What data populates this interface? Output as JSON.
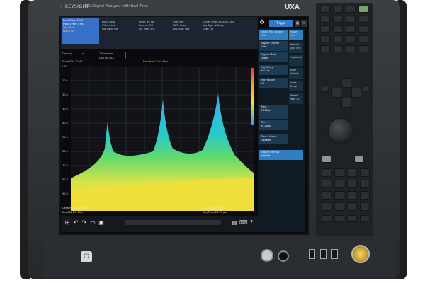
{
  "device": {
    "brand": "KEYSIGHT",
    "title": "UXA Signal Analyzer with Real-Time",
    "model": "UXA"
  },
  "screen": {
    "control_box": {
      "line1": "Real-Time: 3.0.5",
      "line2": "Sync Time: 3 ms",
      "line3": "Trig: Free",
      "line4": "Input: RF"
    },
    "info_cols": [
      [
        "PNO: Close",
        "IFGain: Low",
        "Sig Track: Off"
      ],
      [
        "Atten: 10 dB",
        "Preamp: Off",
        "µW Path: Std"
      ],
      [
        "Trig: Free",
        "PA/C: Swep",
        "Avg Type: Log"
      ],
      [
        "Center Freq: 5.00000 GHz",
        "Avg Type: Voltage",
        "Gate: Off"
      ]
    ],
    "sub_bar": {
      "view_label": "Density",
      "box_line1": "1 Spectrum",
      "box_line2": "DIGITAL OLS",
      "scale": "Scale/Div 10 dB",
      "ref": "Ref Level 0.00 dBm"
    },
    "y_labels": [
      "0.00",
      "-10.0",
      "-20.0",
      "-30.0",
      "-40.0",
      "-50.0",
      "-60.0",
      "-70.0",
      "-80.0",
      "-90.0"
    ],
    "bottom": {
      "center": "Center 5.00000 GHz",
      "rbw": "Res BW 1.0 MHz",
      "span": "Span 160.0 MHz",
      "sweep": "Acq Time 20.57 µs"
    },
    "side_panel": {
      "tab": "Trigger",
      "items": [
        {
          "label": "Select Trig Source",
          "value": "Free"
        },
        {
          "label": "Trigger Criteria",
          "value": "Over"
        },
        {
          "label": "Trigger Mask",
          "value": "Upper"
        },
        {
          "label": "Trig Delay",
          "value": "50.0 ns"
        },
        {
          "label": "Trig Holdoff",
          "value": "Off"
        },
        {
          "label": "Time 1",
          "value": "5.000 µs"
        },
        {
          "label": "Time 2",
          "value": "35.00 µs"
        },
        {
          "label": "Time Criteria",
          "value": "Disabled"
        },
        {
          "label": "Trigger Density",
          "value": "Applied"
        }
      ],
      "right_items": [
        {
          "label": "Trigger",
          "value": "Free"
        },
        {
          "label": "Periodic",
          "value": "Sync Src"
        },
        {
          "label": "Freq Mask",
          "value": ""
        },
        {
          "label": "Auto/",
          "value": "Holdoff"
        },
        {
          "label": "Quick Setup",
          "value": ""
        },
        {
          "label": "Shared",
          "value": "Peak 52"
        }
      ]
    }
  }
}
